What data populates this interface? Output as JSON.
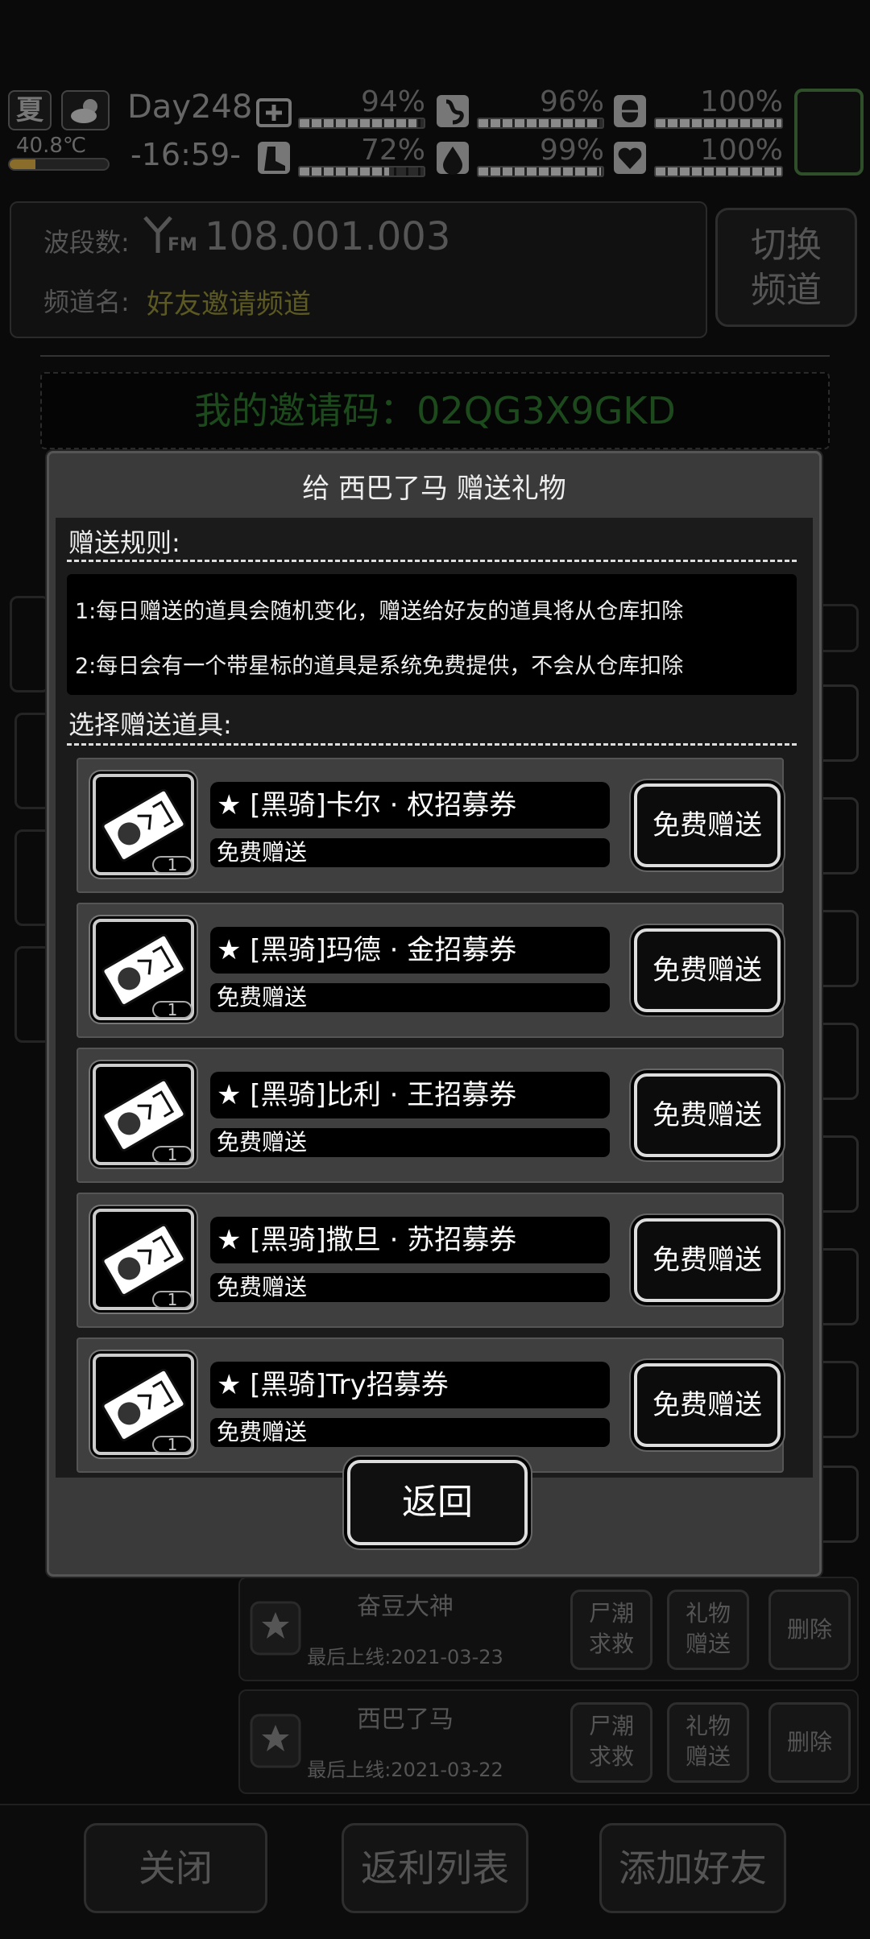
{
  "status": {
    "season": "夏",
    "day": "Day248",
    "temperature": "40.8℃",
    "time": "-16:59-",
    "stats": [
      {
        "icon": "medkit-icon",
        "percent_label": "94%",
        "value": 0.94
      },
      {
        "icon": "stomach-icon",
        "percent_label": "96%",
        "value": 0.96
      },
      {
        "icon": "pill-icon",
        "percent_label": "100%",
        "value": 1.0
      },
      {
        "icon": "boot-icon",
        "percent_label": "72%",
        "value": 0.72
      },
      {
        "icon": "water-drop-icon",
        "percent_label": "99%",
        "value": 0.99
      },
      {
        "icon": "heart-icon",
        "percent_label": "100%",
        "value": 1.0
      }
    ]
  },
  "radio": {
    "band_label": "波段数:",
    "frequency": "108.001.003",
    "fm_label": "FM",
    "channel_label": "频道名:",
    "channel_name": "好友邀请频道",
    "switch_label_1": "切换",
    "switch_label_2": "频道",
    "invite_code": "我的邀请码：02QG3X9GKD"
  },
  "friends_bg": [
    {
      "name": "奋豆大神",
      "last_online": "最后上线:2021-03-23",
      "rescue": [
        "尸潮",
        "求救"
      ],
      "gift": [
        "礼物",
        "赠送"
      ],
      "delete": "删除"
    },
    {
      "name": "西巴了马",
      "last_online": "最后上线:2021-03-22",
      "rescue": [
        "尸潮",
        "求救"
      ],
      "gift": [
        "礼物",
        "赠送"
      ],
      "delete": "删除"
    }
  ],
  "bottom_buttons": {
    "close": "关闭",
    "rebate": "返利列表",
    "add_friend": "添加好友"
  },
  "modal": {
    "title": "给 西巴了马 赠送礼物",
    "rules_label": "赠送规则:",
    "rules": [
      "1:每日赠送的道具会随机变化，赠送给好友的道具将从仓库扣除",
      "2:每日会有一个带星标的道具是系统免费提供，不会从仓库扣除"
    ],
    "select_label": "选择赠送道具:",
    "items": [
      {
        "name": "★ [黑骑]卡尔 · 权招募券",
        "note": "免费赠送",
        "qty": "1",
        "button": "免费赠送"
      },
      {
        "name": "★ [黑骑]玛德 · 金招募券",
        "note": "免费赠送",
        "qty": "1",
        "button": "免费赠送"
      },
      {
        "name": "★ [黑骑]比利 · 王招募券",
        "note": "免费赠送",
        "qty": "1",
        "button": "免费赠送"
      },
      {
        "name": "★ [黑骑]撒旦 · 苏招募券",
        "note": "免费赠送",
        "qty": "1",
        "button": "免费赠送"
      },
      {
        "name": "★ [黑骑]Try招募券",
        "note": "免费赠送",
        "qty": "1",
        "button": "免费赠送"
      }
    ],
    "back_label": "返回"
  }
}
